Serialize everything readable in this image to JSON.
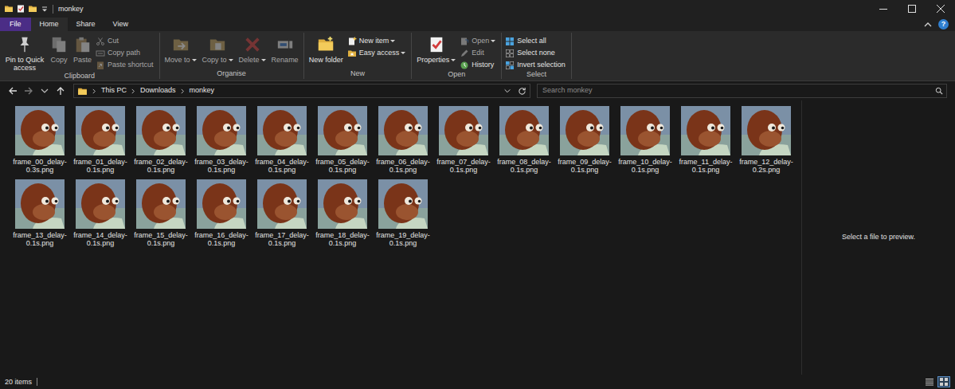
{
  "window": {
    "title": "monkey",
    "help": "?"
  },
  "tabs": [
    {
      "label": "File",
      "selected": false,
      "kind": "file"
    },
    {
      "label": "Home",
      "selected": true,
      "kind": "tab"
    },
    {
      "label": "Share",
      "selected": false,
      "kind": "tab"
    },
    {
      "label": "View",
      "selected": false,
      "kind": "tab"
    }
  ],
  "ribbon": {
    "groups": [
      {
        "label": "Clipboard",
        "items": [
          {
            "label": "Pin to Quick access",
            "kind": "large",
            "disabled": false
          },
          {
            "label": "Copy",
            "kind": "large",
            "disabled": true
          },
          {
            "label": "Paste",
            "kind": "large",
            "disabled": true
          },
          {
            "label": "Cut",
            "kind": "small",
            "disabled": true
          },
          {
            "label": "Copy path",
            "kind": "small",
            "disabled": true
          },
          {
            "label": "Paste shortcut",
            "kind": "small",
            "disabled": true
          }
        ]
      },
      {
        "label": "Organise",
        "items": [
          {
            "label": "Move to",
            "kind": "large-menu",
            "disabled": true
          },
          {
            "label": "Copy to",
            "kind": "large-menu",
            "disabled": true
          },
          {
            "label": "Delete",
            "kind": "large-menu",
            "disabled": true
          },
          {
            "label": "Rename",
            "kind": "large",
            "disabled": true
          }
        ]
      },
      {
        "label": "New",
        "items": [
          {
            "label": "New folder",
            "kind": "large",
            "disabled": false
          },
          {
            "label": "New item",
            "kind": "small-menu",
            "disabled": false
          },
          {
            "label": "Easy access",
            "kind": "small-menu",
            "disabled": false
          }
        ]
      },
      {
        "label": "Open",
        "items": [
          {
            "label": "Properties",
            "kind": "large-menu",
            "disabled": false
          },
          {
            "label": "Open",
            "kind": "small-menu",
            "disabled": true
          },
          {
            "label": "Edit",
            "kind": "small",
            "disabled": true
          },
          {
            "label": "History",
            "kind": "small",
            "disabled": false
          }
        ]
      },
      {
        "label": "Select",
        "items": [
          {
            "label": "Select all",
            "kind": "small",
            "disabled": false
          },
          {
            "label": "Select none",
            "kind": "small",
            "disabled": false
          },
          {
            "label": "Invert selection",
            "kind": "small",
            "disabled": false
          }
        ]
      }
    ]
  },
  "address": {
    "breadcrumb": [
      "This PC",
      "Downloads",
      "monkey"
    ]
  },
  "search": {
    "placeholder": "Search monkey"
  },
  "files": [
    {
      "name": "frame_00_delay-0.3s.png",
      "selected": false
    },
    {
      "name": "frame_01_delay-0.1s.png",
      "selected": false
    },
    {
      "name": "frame_02_delay-0.1s.png",
      "selected": false
    },
    {
      "name": "frame_03_delay-0.1s.png",
      "selected": false
    },
    {
      "name": "frame_04_delay-0.1s.png",
      "selected": false
    },
    {
      "name": "frame_05_delay-0.1s.png",
      "selected": false
    },
    {
      "name": "frame_06_delay-0.1s.png",
      "selected": false
    },
    {
      "name": "frame_07_delay-0.1s.png",
      "selected": false
    },
    {
      "name": "frame_08_delay-0.1s.png",
      "selected": false
    },
    {
      "name": "frame_09_delay-0.1s.png",
      "selected": false
    },
    {
      "name": "frame_10_delay-0.1s.png",
      "selected": false
    },
    {
      "name": "frame_11_delay-0.1s.png",
      "selected": false
    },
    {
      "name": "frame_12_delay-0.2s.png",
      "selected": false
    },
    {
      "name": "frame_13_delay-0.1s.png",
      "selected": false
    },
    {
      "name": "frame_14_delay-0.1s.png",
      "selected": false
    },
    {
      "name": "frame_15_delay-0.1s.png",
      "selected": false
    },
    {
      "name": "frame_16_delay-0.1s.png",
      "selected": false
    },
    {
      "name": "frame_17_delay-0.1s.png",
      "selected": false
    },
    {
      "name": "frame_18_delay-0.1s.png",
      "selected": false
    },
    {
      "name": "frame_19_delay-0.1s.png",
      "selected": false
    }
  ],
  "preview": {
    "message": "Select a file to preview."
  },
  "status_bar": {
    "count": "20 items",
    "views": [
      {
        "kind": "details",
        "selected": false
      },
      {
        "kind": "thumbnails",
        "selected": true
      }
    ]
  }
}
